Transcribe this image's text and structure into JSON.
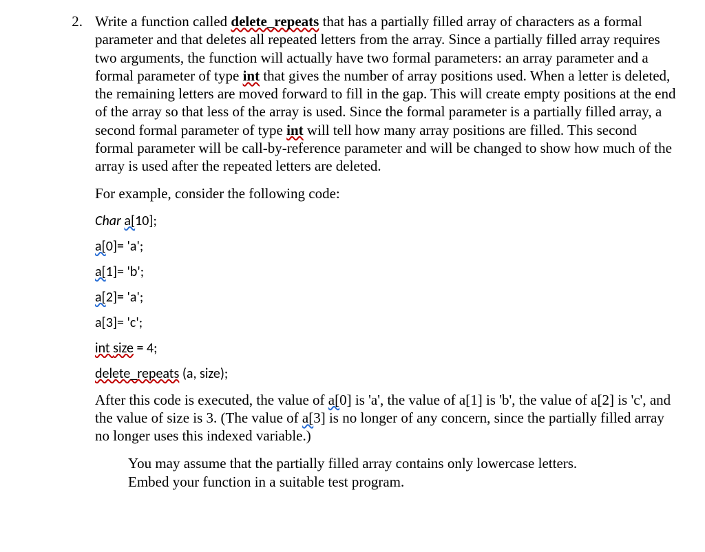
{
  "number": "2.",
  "para1": {
    "t1": "Write a function called ",
    "t2": "delete_repeats",
    "t3": " that has a partially filled array of characters as a formal parameter and that deletes all repeated letters from the array. Since a partially filled array requires two arguments, the function will actually have two formal parameters: an array parameter and a formal parameter of type ",
    "t4": "int",
    "t5": " that gives the number of array positions used. When a letter is deleted, the remaining letters are moved forward to fill in the gap. This will create empty positions at the end of the array so that less of the array is used. Since the formal parameter is a partially filled array, a second formal parameter of type ",
    "t6": "int",
    "t7": " will tell how many array positions are filled. This second formal parameter will be call-by-reference parameter and will be changed to show how much of the array is used after the repeated letters are deleted."
  },
  "para2": "For example, consider the following code:",
  "code": {
    "l1a": "Char ",
    "l1b": "a[",
    "l1c": "10];",
    "l2a": "a[",
    "l2b": "0]= 'a';",
    "l3a": "a[",
    "l3b": "1]= 'b';",
    "l4a": "a[",
    "l4b": "2]= 'a';",
    "l5": "a[3]= 'c';",
    "l6a": "int ",
    "l6b": "size",
    "l6c": " = 4;",
    "l7a": "delete_repeats",
    "l7b": " (a, size);"
  },
  "para3": {
    "t1": "After this code is executed, the value of ",
    "t2": "a[",
    "t3": "0] is 'a', the value of a[1] is 'b', the value of a[2] is 'c', and the value of size is 3. (The value of ",
    "t4": "a[",
    "t5": "3] is no longer of any concern, since the partially filled array no longer uses this indexed variable.)"
  },
  "note1": "You may assume that the partially filled array contains only lowercase letters.",
  "note2": "Embed your function in a suitable test program."
}
